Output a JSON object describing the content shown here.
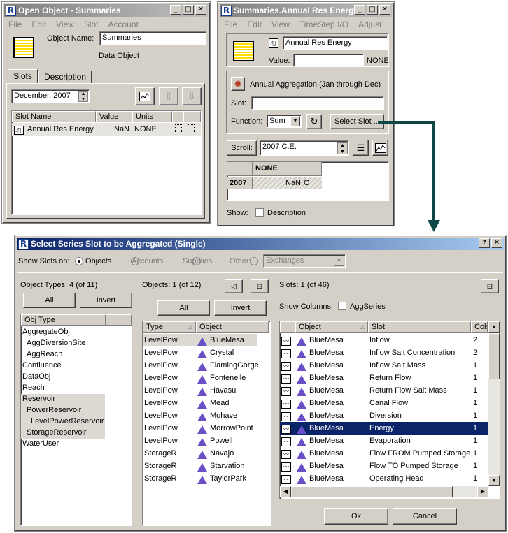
{
  "win1": {
    "title": "Open Object - Summaries",
    "menu": [
      "File",
      "Edit",
      "View",
      "Slot",
      "Account"
    ],
    "object_name_label": "Object Name:",
    "object_name_value": "Summaries",
    "object_type": "Data Object",
    "tabs": [
      "Slots",
      "Description"
    ],
    "date_value": "December, 2007",
    "slot_table": {
      "headers": [
        "Slot Name",
        "Value",
        "Units"
      ],
      "rows": [
        {
          "name": "Annual Res Energy",
          "value": "NaN",
          "units": "NONE"
        }
      ]
    }
  },
  "win2": {
    "title": "Summaries.Annual Res Energy",
    "menu": [
      "File",
      "Edit",
      "View",
      "TimeStep I/O",
      "Adjust"
    ],
    "slot_name": "Annual Res Energy",
    "value_label": "Value:",
    "value_units": "NONE",
    "aggregation_label": "Annual Aggregation (Jan through Dec)",
    "slot_label": "Slot:",
    "function_label": "Function:",
    "function_value": "Sum",
    "select_slot_button": "Select Slot ...",
    "scroll_button": "Scroll:",
    "scroll_value": "2007 C.E.",
    "grid_header": "NONE",
    "grid_row_label": "2007",
    "grid_row_value": "NaN",
    "grid_row_flag": "O",
    "show_label": "Show:",
    "description_checkbox": "Description"
  },
  "dialog": {
    "title": "Select Series Slot to be Aggregated (Single)",
    "help_button": "?",
    "show_slots_on": "Show Slots on:",
    "radios": [
      "Objects",
      "Accounts",
      "Supplies",
      "Other:"
    ],
    "other_select": "Exchanges",
    "object_types_label": "Object Types: 4 (of 11)",
    "all_button": "All",
    "invert_button": "Invert",
    "obj_type_header": "Obj Type",
    "obj_types": [
      "AggregateObj",
      "AggDiversionSite",
      "AggReach",
      "Confluence",
      "DataObj",
      "Reach",
      "Reservoir",
      "PowerReservoir",
      "LevelPowerReservoir",
      "StorageReservoir",
      "WaterUser"
    ],
    "objects_label": "Objects: 1 (of 12)",
    "objects_headers": [
      "Type",
      "Object"
    ],
    "objects": [
      {
        "type": "LevelPow",
        "name": "BlueMesa"
      },
      {
        "type": "LevelPow",
        "name": "Crystal"
      },
      {
        "type": "LevelPow",
        "name": "FlamingGorge"
      },
      {
        "type": "LevelPow",
        "name": "Fontenelle"
      },
      {
        "type": "LevelPow",
        "name": "Havasu"
      },
      {
        "type": "LevelPow",
        "name": "Mead"
      },
      {
        "type": "LevelPow",
        "name": "Mohave"
      },
      {
        "type": "LevelPow",
        "name": "MorrowPoint"
      },
      {
        "type": "LevelPow",
        "name": "Powell"
      },
      {
        "type": "StorageR",
        "name": "Navajo"
      },
      {
        "type": "StorageR",
        "name": "Starvation"
      },
      {
        "type": "StorageR",
        "name": "TaylorPark"
      }
    ],
    "slots_label": "Slots: 1 (of 46)",
    "show_columns_label": "Show Columns:",
    "aggseries_checkbox": "AggSeries",
    "slots_headers": [
      "Object",
      "Slot",
      "Cols"
    ],
    "slots": [
      {
        "object": "BlueMesa",
        "slot": "Inflow",
        "cols": "2"
      },
      {
        "object": "BlueMesa",
        "slot": "Inflow Salt Concentration",
        "cols": "2"
      },
      {
        "object": "BlueMesa",
        "slot": "Inflow Salt Mass",
        "cols": "1"
      },
      {
        "object": "BlueMesa",
        "slot": "Return Flow",
        "cols": "1"
      },
      {
        "object": "BlueMesa",
        "slot": "Return Flow Salt Mass",
        "cols": "1"
      },
      {
        "object": "BlueMesa",
        "slot": "Canal Flow",
        "cols": "1"
      },
      {
        "object": "BlueMesa",
        "slot": "Diversion",
        "cols": "1"
      },
      {
        "object": "BlueMesa",
        "slot": "Energy",
        "cols": "1"
      },
      {
        "object": "BlueMesa",
        "slot": "Evaporation",
        "cols": "1"
      },
      {
        "object": "BlueMesa",
        "slot": "Flow FROM Pumped Storage",
        "cols": "1"
      },
      {
        "object": "BlueMesa",
        "slot": "Flow TO Pumped Storage",
        "cols": "1"
      },
      {
        "object": "BlueMesa",
        "slot": "Operating Head",
        "cols": "1"
      }
    ],
    "ok_button": "Ok",
    "cancel_button": "Cancel"
  },
  "colors": {
    "selection": "#0a246a",
    "light_selection": "#d4d0c8",
    "arrow": "#0f4747"
  }
}
